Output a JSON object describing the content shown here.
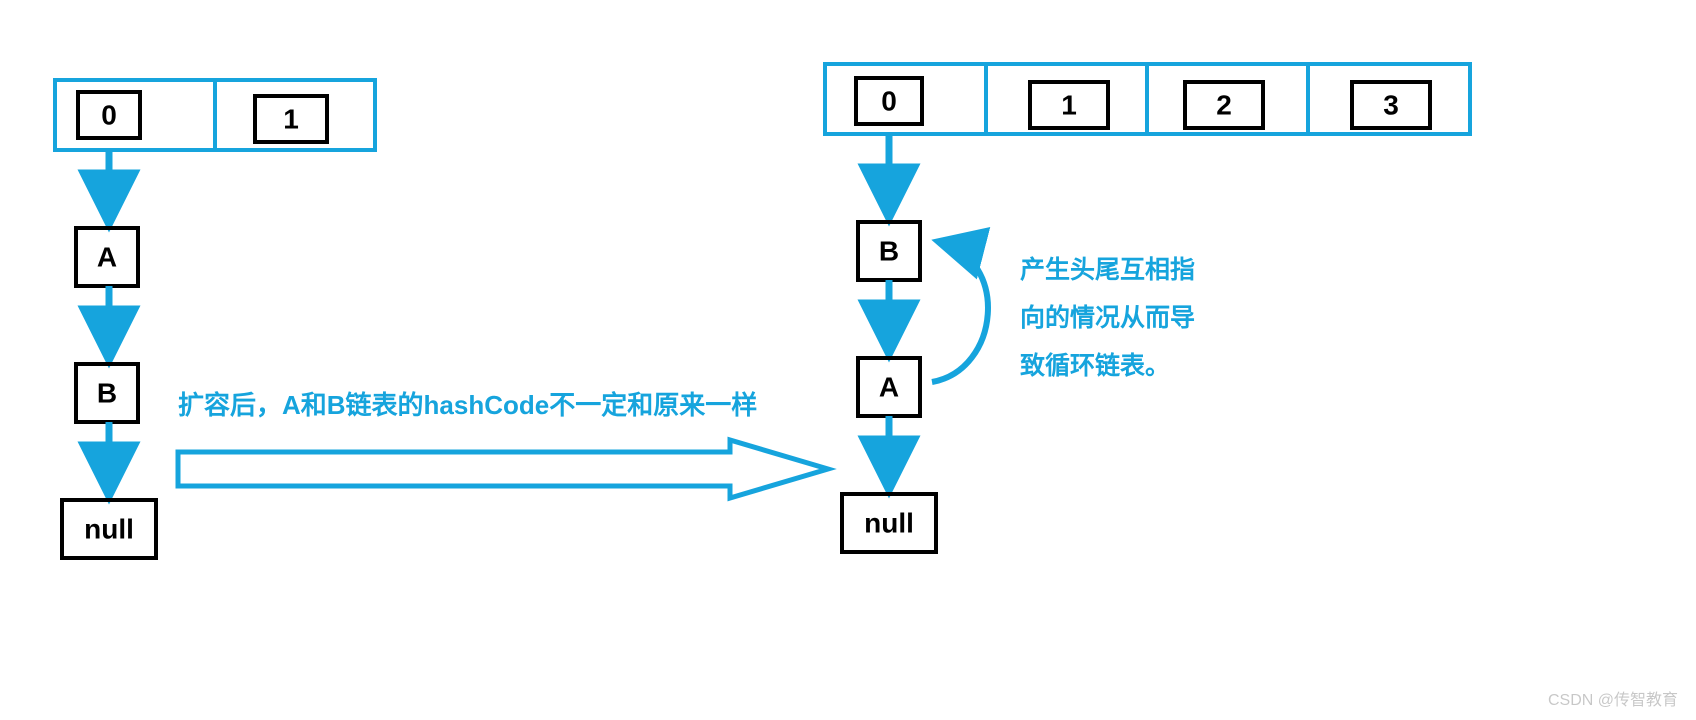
{
  "colors": {
    "stroke_blue": "#16a4dd",
    "stroke_black": "#000000",
    "text_blue": "#16a4dd"
  },
  "left_array": {
    "buckets": [
      "0",
      "1"
    ]
  },
  "right_array": {
    "buckets": [
      "0",
      "1",
      "2",
      "3"
    ]
  },
  "left_chain": {
    "nodes": [
      "A",
      "B",
      "null"
    ]
  },
  "right_chain": {
    "nodes": [
      "B",
      "A",
      "null"
    ]
  },
  "caption_middle": "扩容后，A和B链表的hashCode不一定和原来一样",
  "caption_right_lines": [
    "产生头尾互相指",
    "向的情况从而导",
    "致循环链表。"
  ],
  "watermark": "CSDN @传智教育"
}
